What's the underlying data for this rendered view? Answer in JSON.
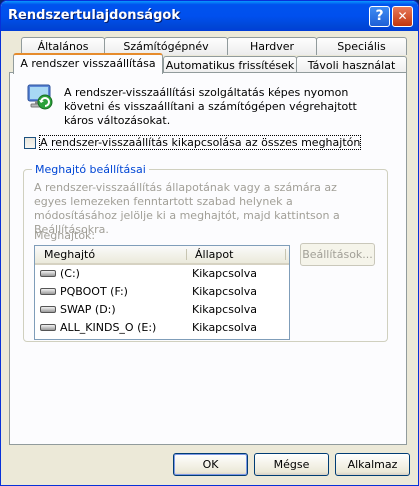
{
  "window": {
    "title": "Rendszertulajdonságok",
    "help_glyph": "?",
    "close_glyph": "✕"
  },
  "tabs": {
    "row1": [
      "Általános",
      "Számítógépnév",
      "Hardver",
      "Speciális"
    ],
    "row2": [
      "A rendszer visszaállítása",
      "Automatikus frissítések",
      "Távoli használat"
    ],
    "active": "A rendszer visszaállítása"
  },
  "restore": {
    "description": "A rendszer-visszaállítási szolgáltatás képes nyomon követni és visszaállítani a számítógépen végrehajtott káros változásokat.",
    "checkbox_label": "A rendszer-visszaállítás kikapcsolása az összes meghajtón",
    "checkbox_checked": false
  },
  "drive_settings": {
    "group_title": "Meghajtó beállításai",
    "help_text": "A rendszer-visszaállítás állapotának vagy a számára az egyes lemezeken fenntartott szabad helynek a módosításához jelölje ki a meghajtót, majd kattintson a Beállításokra.",
    "drives_label": "Meghajtók:",
    "columns": [
      "Meghajtó",
      "Állapot"
    ],
    "drives": [
      {
        "name": "(C:)",
        "status": "Kikapcsolva"
      },
      {
        "name": "PQBOOT (F:)",
        "status": "Kikapcsolva"
      },
      {
        "name": "SWAP (D:)",
        "status": "Kikapcsolva"
      },
      {
        "name": "ALL_KINDS_O (E:)",
        "status": "Kikapcsolva"
      }
    ],
    "settings_button": "Beállítások..."
  },
  "footer": {
    "ok": "OK",
    "cancel": "Mégse",
    "apply": "Alkalmaz"
  },
  "icons": {
    "help": "help-icon",
    "close": "close-icon",
    "restore": "system-restore-icon",
    "drive": "hard-drive-icon"
  }
}
